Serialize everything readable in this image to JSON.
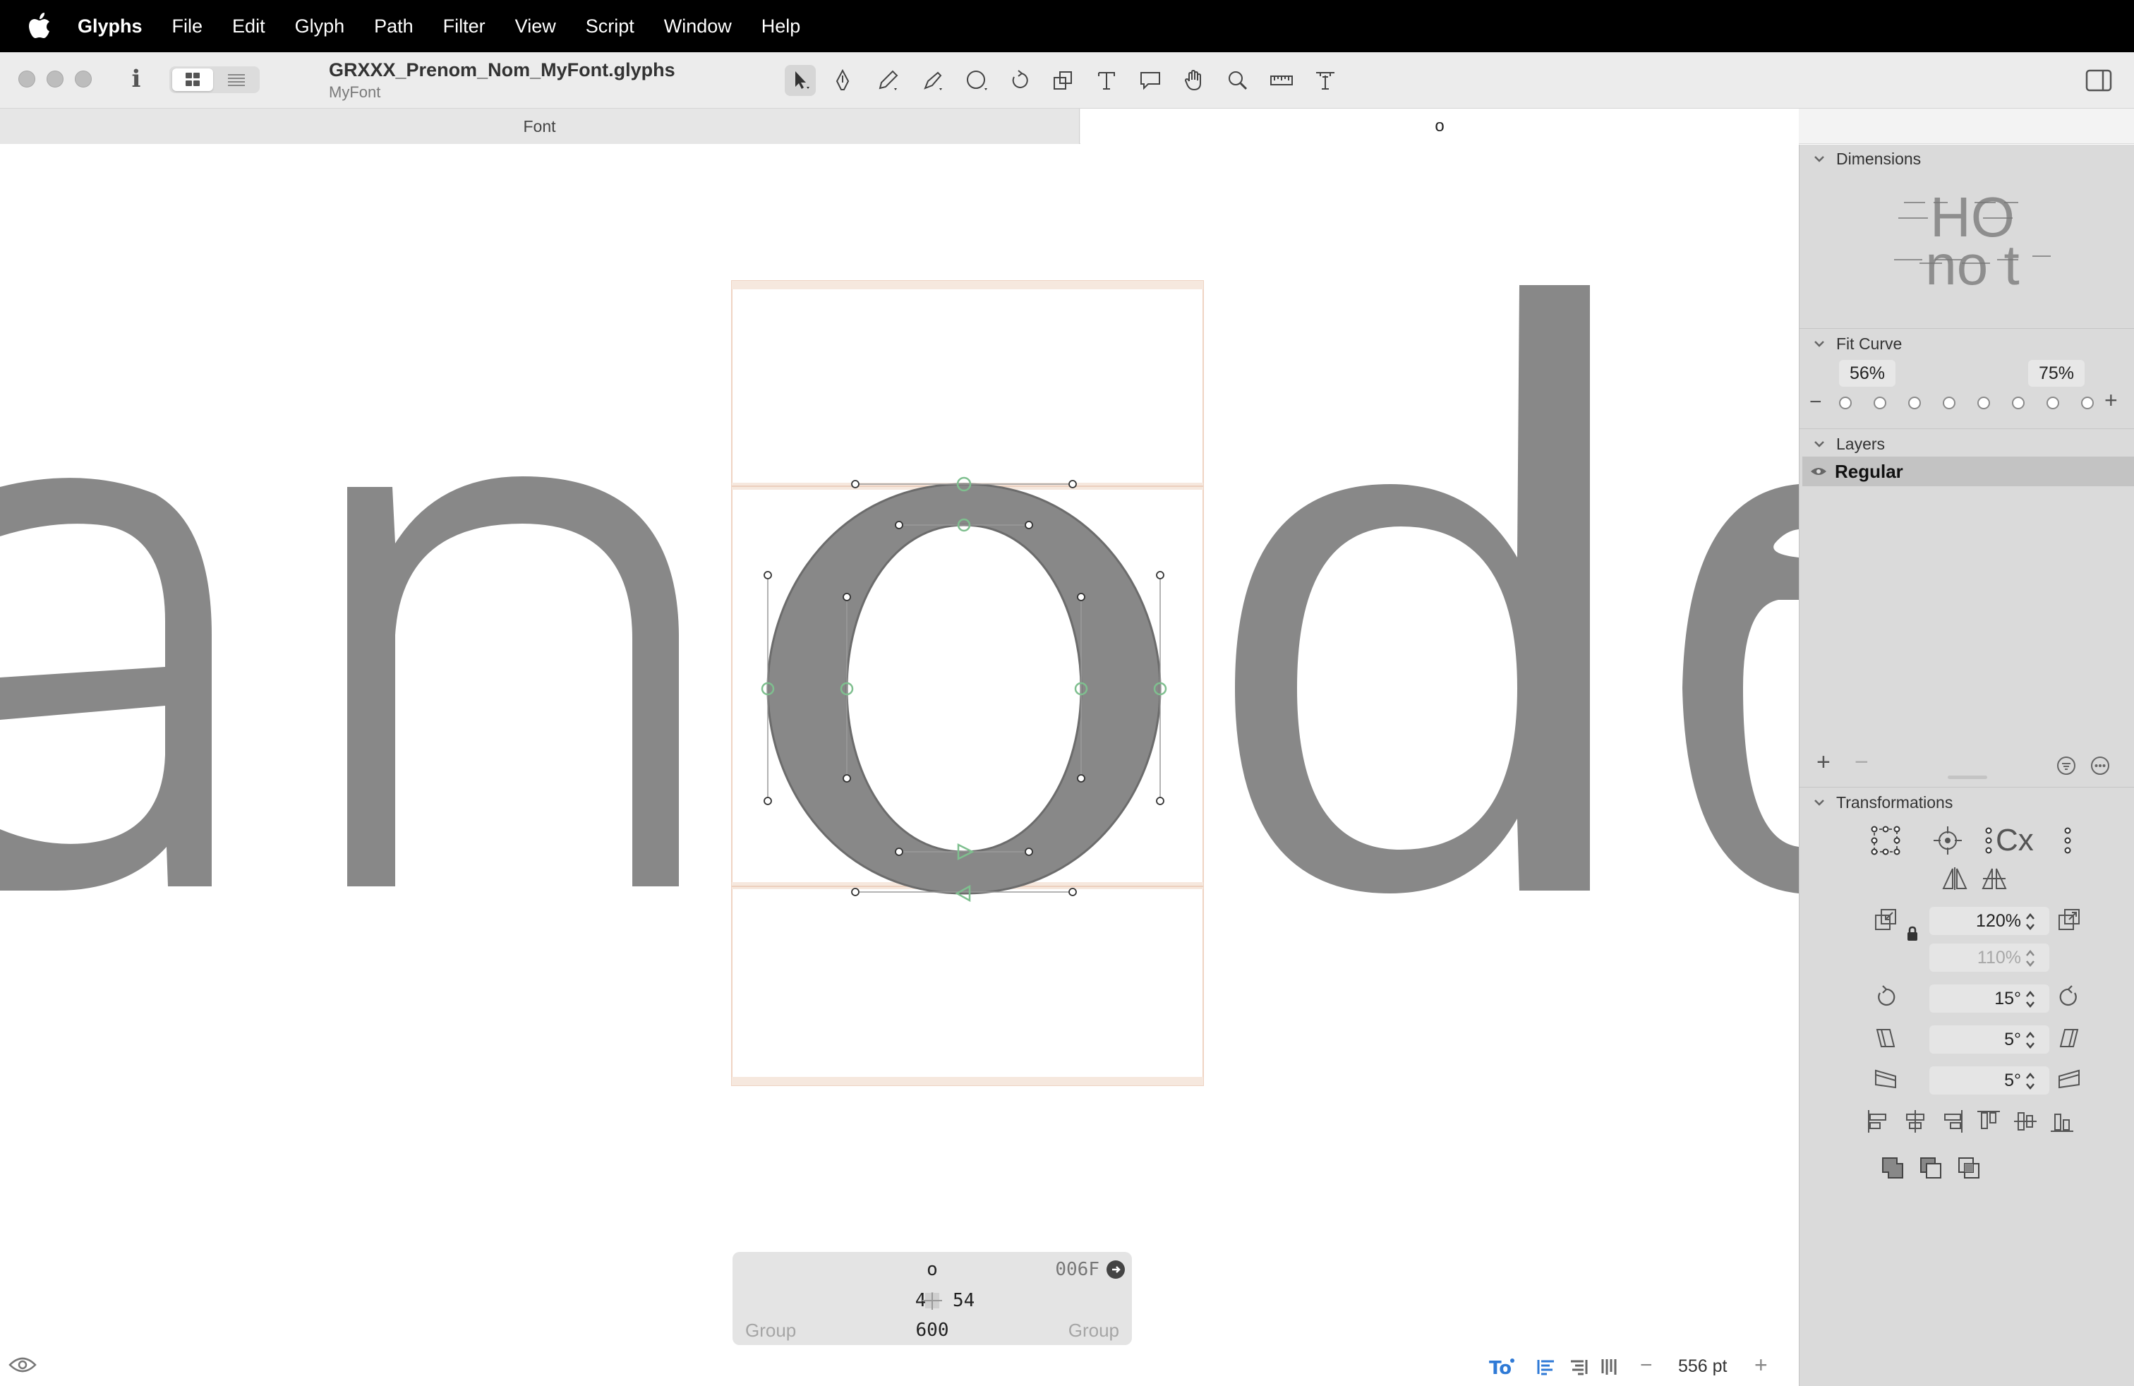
{
  "menubar": {
    "app_name": "Glyphs",
    "items": [
      "File",
      "Edit",
      "Glyph",
      "Path",
      "Filter",
      "View",
      "Script",
      "Window",
      "Help"
    ]
  },
  "toolbar": {
    "doc_title": "GRXXX_Prenom_Nom_MyFont.glyphs",
    "doc_subtitle": "MyFont",
    "info_label": "i",
    "tools": [
      "select-tool",
      "draw-tool",
      "pencil-tool",
      "brush-tool",
      "primitives-tool",
      "rotate-tool",
      "scale-tool",
      "text-tool",
      "annotation-tool",
      "hand-tool",
      "zoom-tool",
      "measure-tool",
      "metrics-tool"
    ]
  },
  "tabs": {
    "font_tab": "Font",
    "glyph_tab": "o"
  },
  "canvas": {
    "text_string": "anode",
    "active_glyph": "o",
    "glyph_color": "#8a8a8a",
    "node_color": "#7fbf8f"
  },
  "glyph_info": {
    "name": "o",
    "unicode": "006F",
    "lsb": "46",
    "rsb": "54",
    "width": "600",
    "left_group": "Group",
    "right_group": "Group"
  },
  "status": {
    "zoom": "556 pt",
    "zoom_minus": "−",
    "zoom_plus": "+"
  },
  "sidebar": {
    "dimensions": {
      "title": "Dimensions",
      "sample_top": "HO",
      "sample_bottom": "no t"
    },
    "fit_curve": {
      "title": "Fit Curve",
      "left_value": "56%",
      "right_value": "75%",
      "minus": "−",
      "plus": "+",
      "dot_count": 8
    },
    "layers": {
      "title": "Layers",
      "items": [
        "Regular"
      ],
      "add": "+",
      "remove": "−"
    },
    "transformations": {
      "title": "Transformations",
      "scale": "120%",
      "scale_secondary": "110%",
      "rotate": "15°",
      "slant_horizontal": "5°",
      "slant_vertical": "5°"
    }
  },
  "colors": {
    "menubar_bg": "#000000",
    "toolbar_bg": "#ececec",
    "sidebar_bg": "#dadada",
    "metric_line": "#f0d8c8"
  }
}
